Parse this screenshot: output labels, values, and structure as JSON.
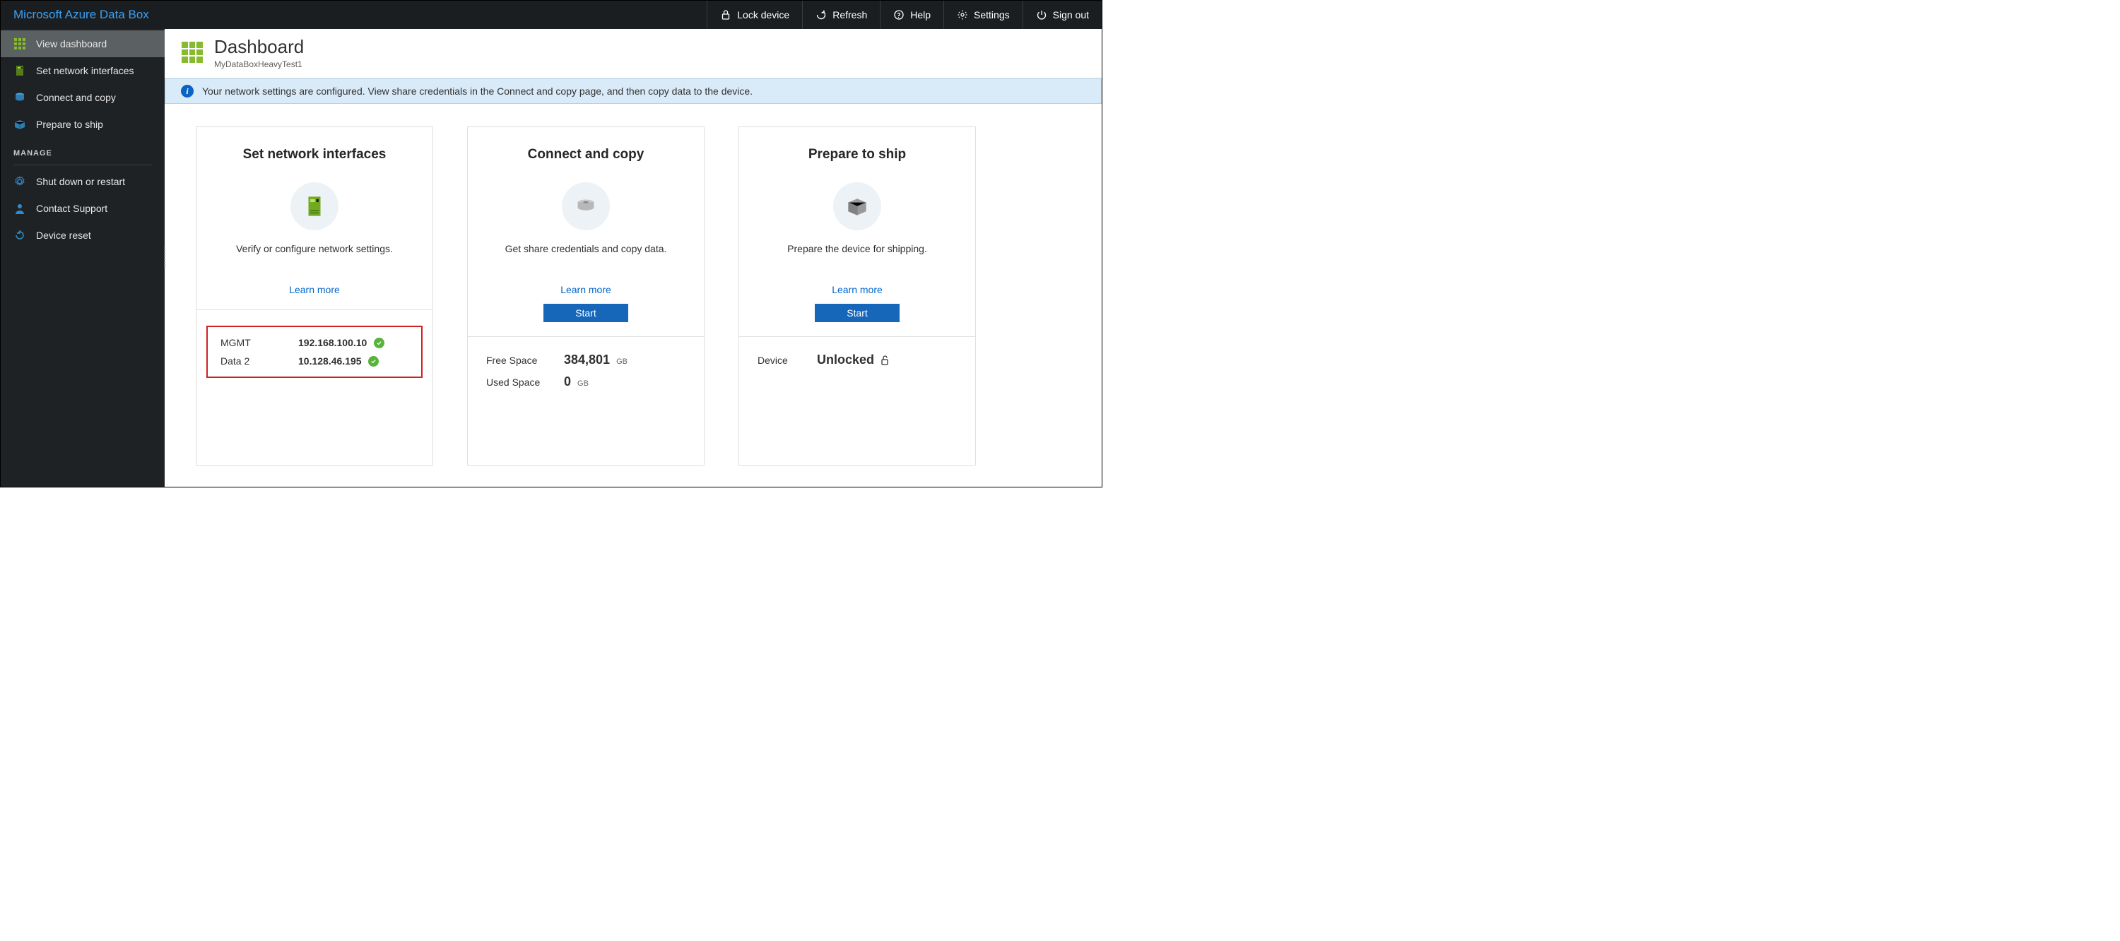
{
  "brand": "Microsoft Azure Data Box",
  "topbar": {
    "lock": "Lock device",
    "refresh": "Refresh",
    "help": "Help",
    "settings": "Settings",
    "signout": "Sign out"
  },
  "sidebar": {
    "items": [
      {
        "label": "View dashboard"
      },
      {
        "label": "Set network interfaces"
      },
      {
        "label": "Connect and copy"
      },
      {
        "label": "Prepare to ship"
      }
    ],
    "section": "MANAGE",
    "manage_items": [
      {
        "label": "Shut down or restart"
      },
      {
        "label": "Contact Support"
      },
      {
        "label": "Device reset"
      }
    ]
  },
  "header": {
    "title": "Dashboard",
    "subtitle": "MyDataBoxHeavyTest1"
  },
  "banner": "Your network settings are configured. View share credentials in the Connect and copy page, and then copy data to the device.",
  "cards": {
    "network": {
      "title": "Set network interfaces",
      "desc": "Verify or configure network settings.",
      "learn_more": "Learn more",
      "rows": [
        {
          "label": "MGMT",
          "value": "192.168.100.10",
          "ok": true
        },
        {
          "label": "Data 2",
          "value": "10.128.46.195",
          "ok": true
        }
      ]
    },
    "connect": {
      "title": "Connect and copy",
      "desc": "Get share credentials and copy data.",
      "learn_more": "Learn more",
      "start": "Start",
      "rows": [
        {
          "label": "Free Space",
          "value": "384,801",
          "unit": "GB"
        },
        {
          "label": "Used Space",
          "value": "0",
          "unit": "GB"
        }
      ]
    },
    "ship": {
      "title": "Prepare to ship",
      "desc": "Prepare the device for shipping.",
      "learn_more": "Learn more",
      "start": "Start",
      "device_label": "Device",
      "device_status": "Unlocked"
    }
  }
}
